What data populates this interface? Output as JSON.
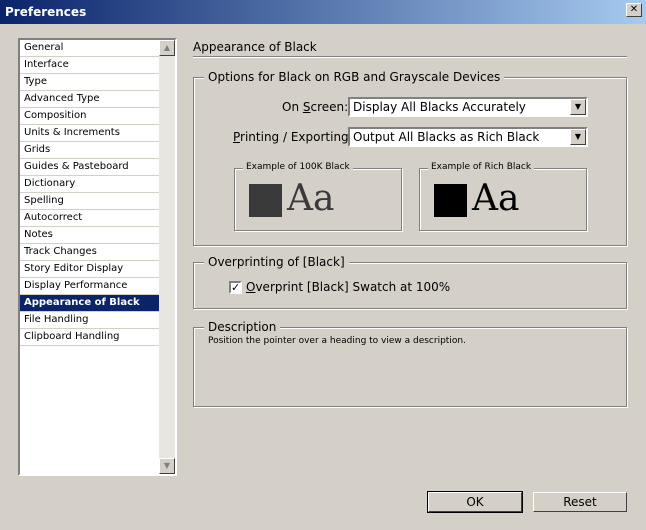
{
  "window": {
    "title": "Preferences",
    "close_glyph": "✕"
  },
  "sidebar": {
    "items": [
      {
        "label": "General"
      },
      {
        "label": "Interface"
      },
      {
        "label": "Type"
      },
      {
        "label": "Advanced Type"
      },
      {
        "label": "Composition"
      },
      {
        "label": "Units & Increments"
      },
      {
        "label": "Grids"
      },
      {
        "label": "Guides & Pasteboard"
      },
      {
        "label": "Dictionary"
      },
      {
        "label": "Spelling"
      },
      {
        "label": "Autocorrect"
      },
      {
        "label": "Notes"
      },
      {
        "label": "Track Changes"
      },
      {
        "label": "Story Editor Display"
      },
      {
        "label": "Display Performance"
      },
      {
        "label": "Appearance of Black"
      },
      {
        "label": "File Handling"
      },
      {
        "label": "Clipboard Handling"
      }
    ],
    "selected_index": 15
  },
  "main": {
    "page_title": "Appearance of Black",
    "options_group": {
      "legend": "Options for Black on RGB and Grayscale Devices",
      "on_screen_label": "On Screen:",
      "on_screen_value": "Display All Blacks Accurately",
      "printing_label": "Printing / Exporting:",
      "printing_value": "Output All Blacks as Rich Black",
      "example_100k_legend": "Example of 100K Black",
      "example_rich_legend": "Example of Rich Black",
      "sample_text": "Aa",
      "color_100k": "#3a3a3a",
      "color_rich": "#000000"
    },
    "overprint_group": {
      "legend": "Overprinting of [Black]",
      "checkbox_label": "Overprint [Black] Swatch at 100%",
      "checked": true,
      "check_glyph": "✓"
    },
    "description_group": {
      "legend": "Description",
      "text": "Position the pointer over a heading to view a description."
    }
  },
  "buttons": {
    "ok": "OK",
    "reset": "Reset"
  },
  "colors": {
    "selection": "#0a246a",
    "dialog": "#d4d0c8"
  }
}
